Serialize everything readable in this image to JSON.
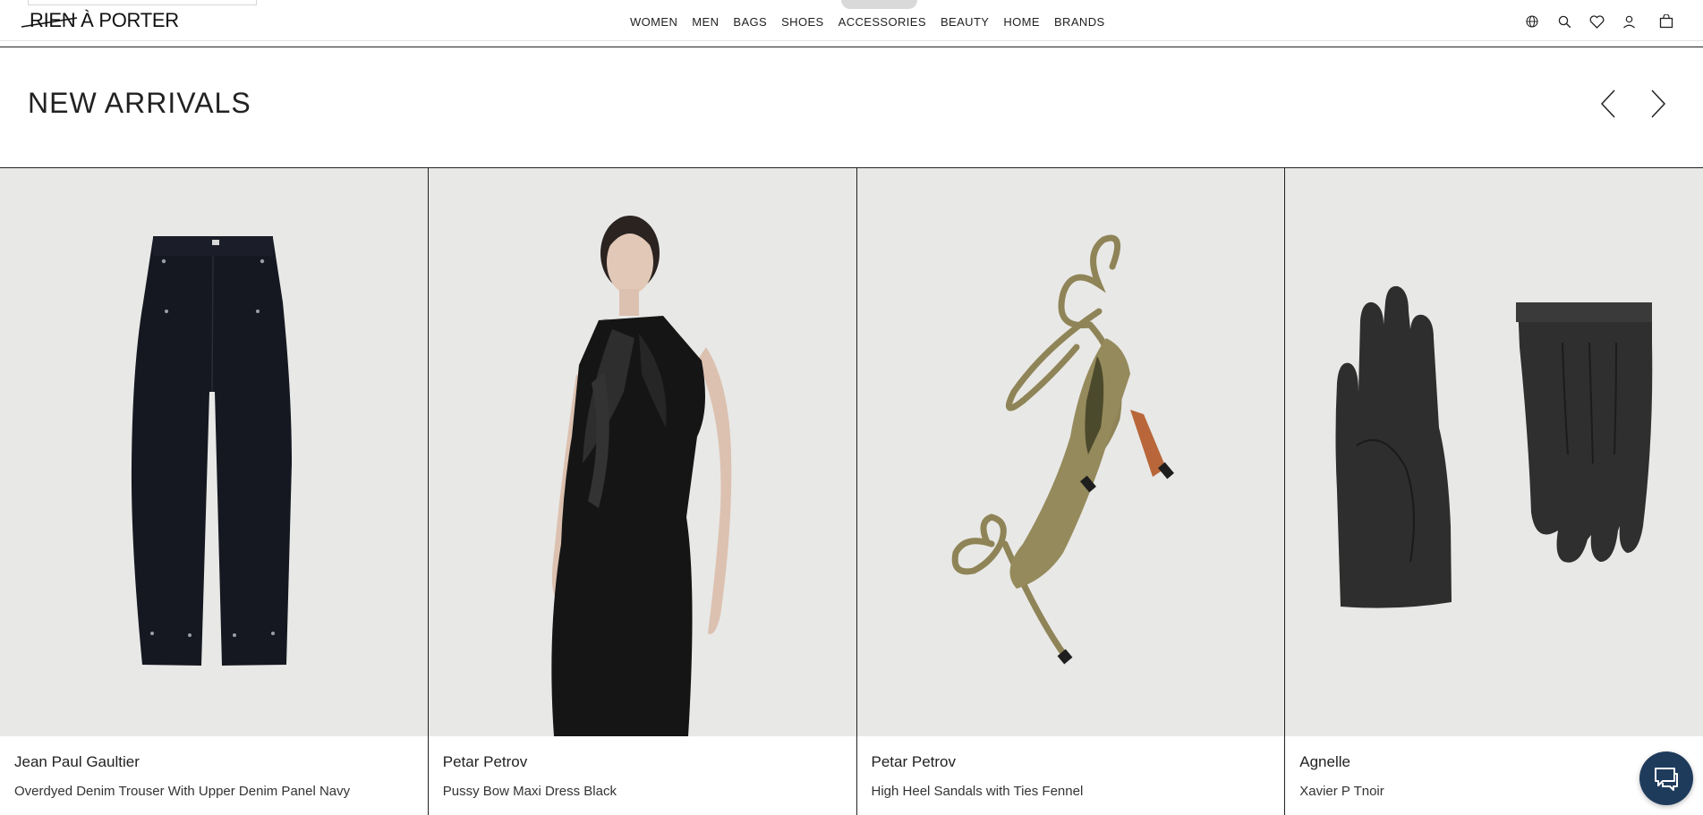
{
  "header": {
    "logo": "RIEN À PORTER",
    "nav": [
      "WOMEN",
      "MEN",
      "BAGS",
      "SHOES",
      "ACCESSORIES",
      "BEAUTY",
      "HOME",
      "BRANDS"
    ],
    "icons": [
      "globe-icon",
      "search-icon",
      "heart-icon",
      "user-icon",
      "bag-icon"
    ]
  },
  "section": {
    "title": "NEW ARRIVALS"
  },
  "products": [
    {
      "brand": "Jean Paul Gaultier",
      "name": "Overdyed Denim Trouser With Upper Denim Panel Navy",
      "image": "navy-trousers"
    },
    {
      "brand": "Petar Petrov",
      "name": "Pussy Bow Maxi Dress Black",
      "image": "black-dress-model"
    },
    {
      "brand": "Petar Petrov",
      "name": "High Heel Sandals with Ties Fennel",
      "image": "fennel-heel-sandal"
    },
    {
      "brand": "Agnelle",
      "name": "Xavier P Tnoir",
      "image": "black-leather-gloves"
    }
  ],
  "colors": {
    "image_bg": "#e8e8e6",
    "chat_button": "#1f3b5c"
  }
}
